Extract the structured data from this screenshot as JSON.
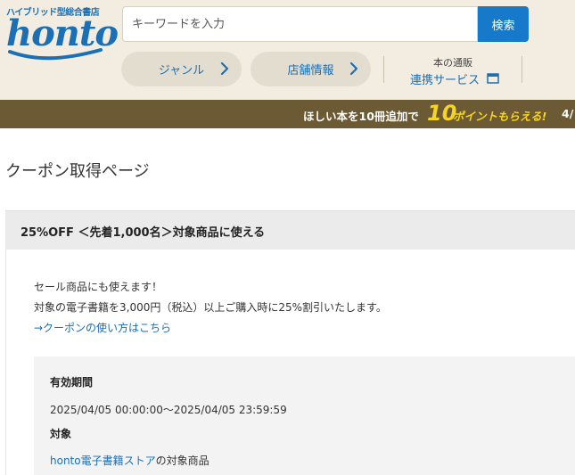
{
  "header": {
    "logo_sub": "ハイブリッド型総合書店",
    "logo_text": "honto",
    "search_placeholder": "キーワードを入力",
    "search_button": "検索",
    "nav": {
      "genre": "ジャンル",
      "store_info": "店舗情報"
    },
    "renkei": {
      "top": "本の通販",
      "main": "連携サービス"
    }
  },
  "promo": {
    "text_before": "ほしい本を10冊追加で",
    "number": "10",
    "highlight": "ポイントもらえる!",
    "text_next": "4/"
  },
  "page": {
    "title": "クーポン取得ページ"
  },
  "coupon": {
    "heading": "25%OFF ＜先着1,000名＞対象商品に使える",
    "desc_line1": "セール商品にも使えます！",
    "desc_line2": "対象の電子書籍を3,000円（税込）以上ご購入時に25%割引いたします。",
    "howto_link": "→クーポンの使い方はこちら",
    "validity_label": "有効期間",
    "validity_value": "2025/04/05 00:00:00～2025/04/05 23:59:59",
    "target_label": "対象",
    "target_link": "honto電子書籍ストア",
    "target_suffix": "の対象商品"
  },
  "colors": {
    "brand_blue": "#1a6fb5",
    "search_button": "#1779c9",
    "header_bg": "#f2ede0",
    "promo_bg": "#6b5a33",
    "promo_highlight": "#f6d325"
  },
  "icons": {
    "logo_swoosh": "honto-swoosh-icon",
    "chevron": "chevron-right-icon",
    "window": "window-icon"
  }
}
